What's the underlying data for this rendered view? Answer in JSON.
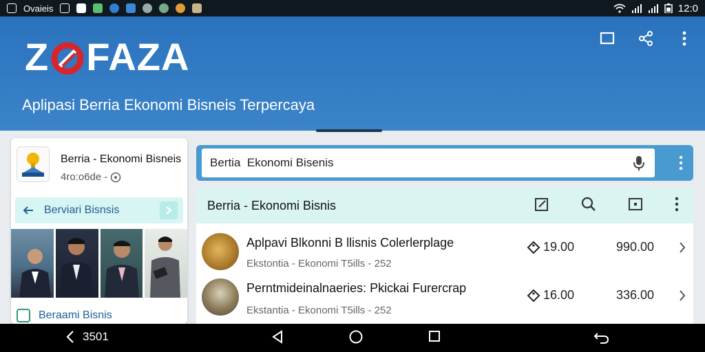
{
  "status_bar": {
    "left_text": "Ovaieis",
    "time": "12:0",
    "icons": [
      "image-icon",
      "mail-icon",
      "app-icon",
      "chrome-icon",
      "info-icon",
      "game-icon",
      "settings-icon",
      "pin-icon",
      "photo-icon",
      "wifi-icon",
      "signal-icon",
      "signal-icon",
      "battery-icon"
    ]
  },
  "app_bar": {
    "logo_prefix": "Z",
    "logo_suffix": "FAZA",
    "tagline": "Aplipasi Berria Ekonomi Bisneis Terpercaya",
    "actions": [
      "square-icon",
      "share-icon",
      "more-vert-icon"
    ]
  },
  "left_card": {
    "title": "Berria - Ekonomi Bisneis",
    "subtitle": "4ro:o6de -",
    "button_label": "Berviari Bisnsis",
    "footer_label": "Beraami Bisnis"
  },
  "search": {
    "value": "Bertia  Ekonomi Bisenis"
  },
  "list_header": {
    "title": "Berria - Ekonomi Bisnis",
    "actions": [
      "edit-icon",
      "search-icon",
      "window-icon",
      "more-vert-icon"
    ]
  },
  "items": [
    {
      "title": "Aplpavi Blkonni B llisnis Colerlerplage",
      "subtitle": "Ekstontia - Ekonomi T5ills - 252",
      "tag": "19.00",
      "price": "990.00"
    },
    {
      "title": "Perntmideinalnaeries: Pkickai Furercrap",
      "subtitle": "Ekstantia - Ekonomi T5ills - 252",
      "tag": "16.00",
      "price": "336.00"
    }
  ],
  "nav_bar": {
    "back_label": "3501"
  },
  "colors": {
    "app_bar": "#2a72bd",
    "accent_teal": "#d9f4f1",
    "logo_red": "#d6262c",
    "link_blue": "#1f5e96"
  }
}
